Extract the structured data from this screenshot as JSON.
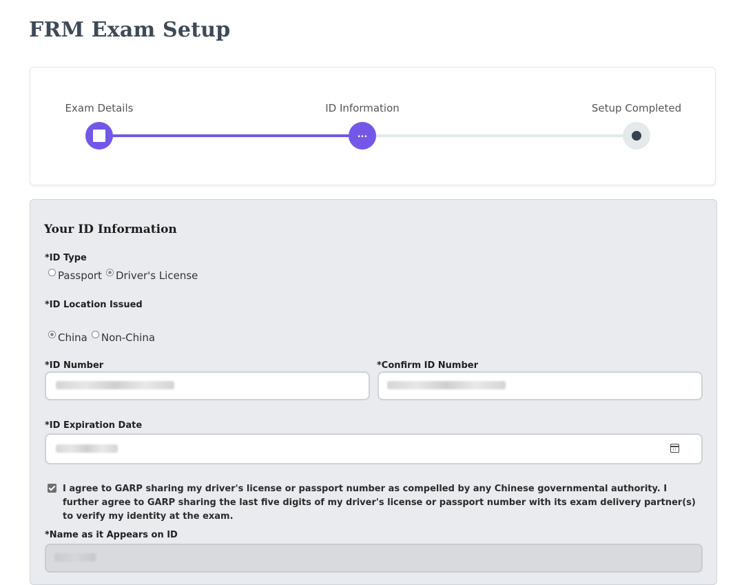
{
  "page": {
    "title": "FRM Exam Setup"
  },
  "stepper": {
    "steps": [
      {
        "label": "Exam Details",
        "state": "done"
      },
      {
        "label": "ID Information",
        "state": "active",
        "indicator": "..."
      },
      {
        "label": "Setup Completed",
        "state": "todo"
      }
    ],
    "accent_color": "#7357e8",
    "track_color": "#e4e9eb"
  },
  "form": {
    "section_title": "Your ID Information",
    "id_type": {
      "label": "*ID Type",
      "options": [
        "Passport",
        "Driver's License"
      ],
      "selected": "Driver's License"
    },
    "id_location": {
      "label": "*ID Location Issued",
      "options": [
        "China",
        "Non-China"
      ],
      "selected": "China"
    },
    "id_number": {
      "label": "*ID Number"
    },
    "confirm_id_number": {
      "label": "*Confirm ID Number"
    },
    "expiration_date": {
      "label": "*ID Expiration Date",
      "icon": "calendar-icon"
    },
    "agreement": {
      "checked": true,
      "text": "I agree to GARP sharing my driver's license or passport number as compelled by any Chinese governmental authority. I further agree to GARP sharing the last five digits of my driver's license or passport number with its exam delivery partner(s) to verify my identity at the exam."
    },
    "name_on_id": {
      "label": "*Name as it Appears on ID"
    }
  }
}
